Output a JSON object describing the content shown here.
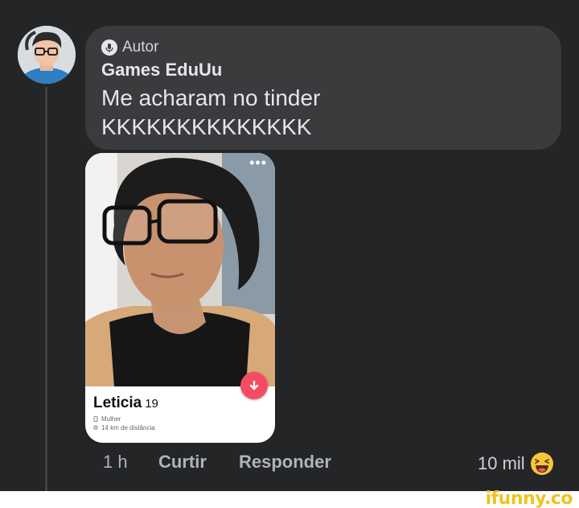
{
  "comment": {
    "badge": "Autor",
    "author": "Games EduUu",
    "lines": [
      "Me acharam no tinder",
      "KKKKKKKKKKKKKK"
    ]
  },
  "card": {
    "name": "Leticia",
    "age": "19",
    "gender": "Mulher",
    "distance": "14 km de distância",
    "menu_dots": "•••"
  },
  "actions": {
    "time": "1 h",
    "like": "Curtir",
    "reply": "Responder"
  },
  "reactions": {
    "count": "10 mil",
    "emoji_icon": "laughing-emoji-icon"
  },
  "watermark": "ifunny.co",
  "colors": {
    "background": "#242526",
    "bubble": "#3a3b3c",
    "dislike": "#f54b64",
    "watermark": "#f2c21c"
  }
}
